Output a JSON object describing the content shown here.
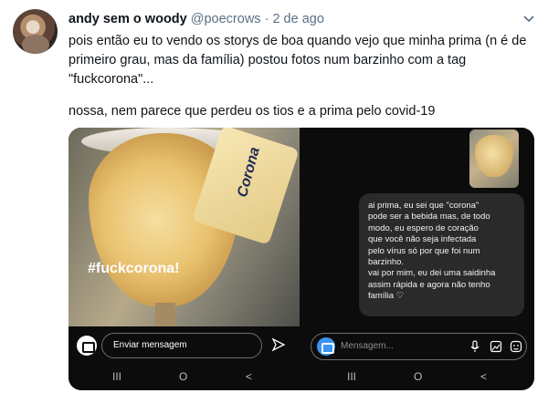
{
  "tweet": {
    "display_name": "andy sem o woody",
    "handle": "@poecrows",
    "separator": "·",
    "time": "2 de ago",
    "paragraph_1": "pois então eu to vendo os storys de boa quando vejo que minha prima (n é de primeiro grau, mas da família) postou fotos num barzinho com a tag \"fuckcorona\"...",
    "paragraph_2": "nossa, nem parece que perdeu os tios e a prima pelo covid-19"
  },
  "left_story": {
    "hashtag": "#fuckcorona!",
    "brand": "Corona",
    "message_placeholder": "Enviar mensagem"
  },
  "right_story": {
    "reply_text": "ai prima, eu sei que \"corona\"\npode ser a bebida mas, de todo\nmodo, eu espero de coração\nque você não seja infectada\npelo vírus só por que foi num\nbarzinho.\nvai por mim, eu dei uma saidinha\nassim rápida e agora não tenho\nfamília ♡",
    "message_placeholder": "Mensagem..."
  },
  "android_nav": {
    "recent": "III",
    "home": "O",
    "back": "<"
  },
  "colors": {
    "text": "#0f1419",
    "muted": "#5b7083",
    "ig_blue": "#3a94f2"
  }
}
